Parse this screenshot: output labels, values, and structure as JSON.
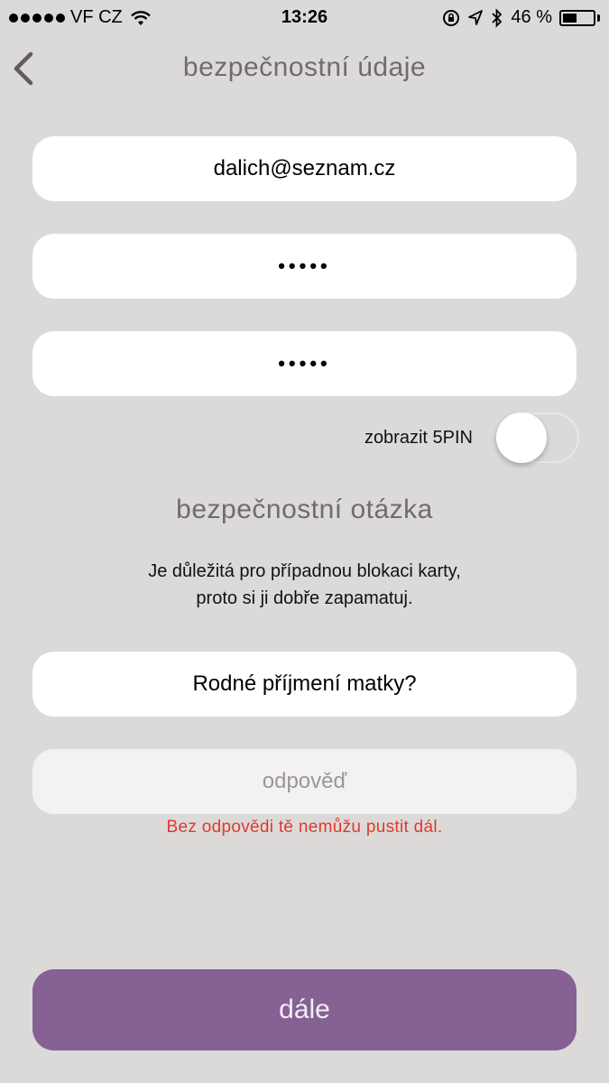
{
  "status_bar": {
    "carrier": "VF CZ",
    "time": "13:26",
    "battery_text": "46 %",
    "battery_level": 0.46
  },
  "nav": {
    "title": "bezpečnostní údaje"
  },
  "form": {
    "email_value": "dalich@seznam.cz",
    "pin_value": "•••••",
    "pin_confirm_value": "•••••",
    "show_pin_label": "zobrazit 5PIN",
    "show_pin_on": false
  },
  "security": {
    "title": "bezpečnostní otázka",
    "helper_line1": "Je důležitá pro případnou blokaci karty,",
    "helper_line2": "proto si ji dobře zapamatuj.",
    "question_value": "Rodné příjmení matky?",
    "answer_placeholder": "odpověď",
    "error": "Bez odpovědi tě nemůžu pustit dál."
  },
  "actions": {
    "next_label": "dále"
  },
  "colors": {
    "background": "#dcdad9",
    "accent": "#856194",
    "error": "#e0392c"
  }
}
